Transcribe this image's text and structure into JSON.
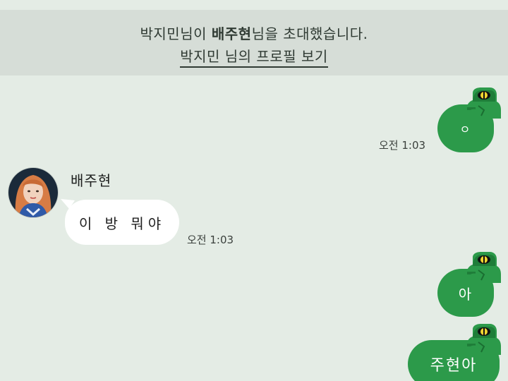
{
  "system_notice": {
    "inviter": "박지민님이",
    "invitee": "배주현",
    "suffix": "님을 초대했습니다.",
    "profile_link": "박지민 님의 프로필 보기"
  },
  "messages": [
    {
      "direction": "sent",
      "text": "ㅇ",
      "time": "오전 1:03"
    },
    {
      "direction": "received",
      "sender": "배주현",
      "text": "이 방 뭐야",
      "time": "오전 1:03"
    },
    {
      "direction": "sent",
      "text": "아"
    },
    {
      "direction": "sent",
      "text": "주현아"
    }
  ],
  "colors": {
    "background": "#e4ece5",
    "notice_background": "#d6ddd7",
    "sent_bubble": "#2c9a4a",
    "received_bubble": "#ffffff"
  },
  "icons": {
    "sticker": "frog-character-icon",
    "avatar": "profile-avatar"
  }
}
